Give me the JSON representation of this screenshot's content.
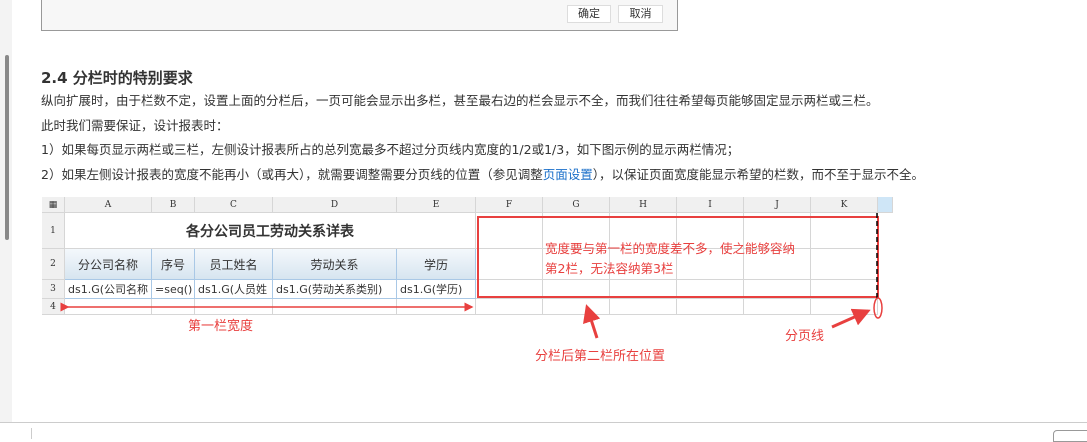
{
  "dialog": {
    "ok_label": "确定",
    "cancel_label": "取消"
  },
  "article": {
    "heading": "2.4 分栏时的特别要求",
    "para1": "纵向扩展时，由于栏数不定，设置上面的分栏后，一页可能会显示出多栏，甚至最右边的栏会显示不全，而我们往往希望每页能够固定显示两栏或三栏。",
    "para2": "此时我们需要保证，设计报表时：",
    "para3": "1）如果每页显示两栏或三栏，左侧设计报表所占的总列宽最多不超过分页线内宽度的1/2或1/3，如下图示例的显示两栏情况；",
    "para4_before": "2）如果左侧设计报表的宽度不能再小（或再大），就需要调整需要分页线的位置（参见调整",
    "para4_link": "页面设置",
    "para4_after": "），以保证页面宽度能显示希望的栏数，而不至于显示不全。"
  },
  "sheet": {
    "corner_icon": "grid-icon",
    "columns": [
      "A",
      "B",
      "C",
      "D",
      "E",
      "F",
      "G",
      "H",
      "I",
      "J",
      "K"
    ],
    "rows": [
      "1",
      "2",
      "3",
      "4"
    ],
    "title": "各分公司员工劳动关系详表",
    "headers": [
      "分公司名称",
      "序号",
      "员工姓名",
      "劳动关系",
      "学历"
    ],
    "cells": [
      "ds1.G(公司名称",
      "=seq()",
      "ds1.G(人员姓",
      "ds1.G(劳动关系类别)",
      "ds1.G(学历)"
    ]
  },
  "annotations": {
    "box_text_line1": "宽度要与第一栏的宽度差不多，使之能够容纳",
    "box_text_line2": "第2栏，无法容纳第3栏",
    "first_col_width": "第一栏宽度",
    "second_col_position": "分栏后第二栏所在位置",
    "page_break_line": "分页线",
    "color": "#e8403f"
  }
}
